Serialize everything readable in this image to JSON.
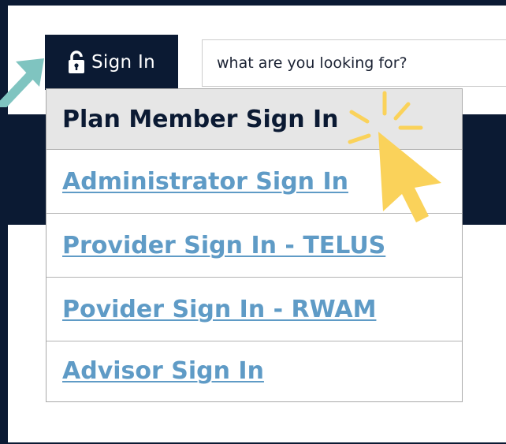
{
  "header": {
    "signin_label": "Sign In",
    "search_placeholder": "what are you looking for?"
  },
  "dropdown": {
    "items": [
      {
        "label": "Plan Member Sign In",
        "active": true
      },
      {
        "label": "Administrator Sign In",
        "active": false
      },
      {
        "label": "Provider Sign In - TELUS",
        "active": false
      },
      {
        "label": "Povider Sign In - RWAM",
        "active": false
      },
      {
        "label": "Advisor Sign In",
        "active": false
      }
    ]
  },
  "colors": {
    "navy": "#0b1a33",
    "link": "#5f9bc6",
    "active_bg": "#e6e6e6",
    "annotation_teal": "#7fc4c0",
    "annotation_yellow": "#fad25a"
  },
  "icons": {
    "lock": "lock-icon",
    "arrow": "arrow-annotation-icon",
    "cursor": "pointer-cursor-icon"
  }
}
